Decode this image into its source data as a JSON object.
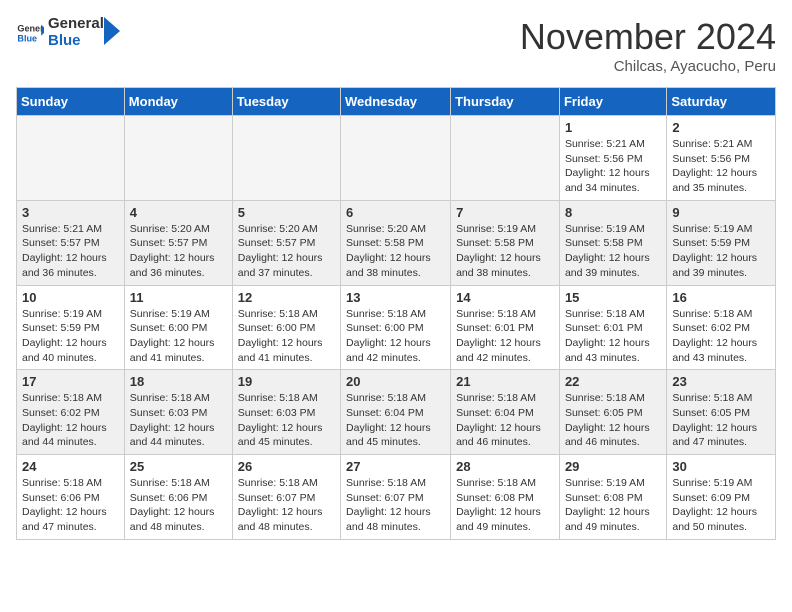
{
  "header": {
    "logo_general": "General",
    "logo_blue": "Blue",
    "month_title": "November 2024",
    "location": "Chilcas, Ayacucho, Peru"
  },
  "weekdays": [
    "Sunday",
    "Monday",
    "Tuesday",
    "Wednesday",
    "Thursday",
    "Friday",
    "Saturday"
  ],
  "weeks": [
    [
      {
        "day": "",
        "info": ""
      },
      {
        "day": "",
        "info": ""
      },
      {
        "day": "",
        "info": ""
      },
      {
        "day": "",
        "info": ""
      },
      {
        "day": "",
        "info": ""
      },
      {
        "day": "1",
        "info": "Sunrise: 5:21 AM\nSunset: 5:56 PM\nDaylight: 12 hours\nand 34 minutes."
      },
      {
        "day": "2",
        "info": "Sunrise: 5:21 AM\nSunset: 5:56 PM\nDaylight: 12 hours\nand 35 minutes."
      }
    ],
    [
      {
        "day": "3",
        "info": "Sunrise: 5:21 AM\nSunset: 5:57 PM\nDaylight: 12 hours\nand 36 minutes."
      },
      {
        "day": "4",
        "info": "Sunrise: 5:20 AM\nSunset: 5:57 PM\nDaylight: 12 hours\nand 36 minutes."
      },
      {
        "day": "5",
        "info": "Sunrise: 5:20 AM\nSunset: 5:57 PM\nDaylight: 12 hours\nand 37 minutes."
      },
      {
        "day": "6",
        "info": "Sunrise: 5:20 AM\nSunset: 5:58 PM\nDaylight: 12 hours\nand 38 minutes."
      },
      {
        "day": "7",
        "info": "Sunrise: 5:19 AM\nSunset: 5:58 PM\nDaylight: 12 hours\nand 38 minutes."
      },
      {
        "day": "8",
        "info": "Sunrise: 5:19 AM\nSunset: 5:58 PM\nDaylight: 12 hours\nand 39 minutes."
      },
      {
        "day": "9",
        "info": "Sunrise: 5:19 AM\nSunset: 5:59 PM\nDaylight: 12 hours\nand 39 minutes."
      }
    ],
    [
      {
        "day": "10",
        "info": "Sunrise: 5:19 AM\nSunset: 5:59 PM\nDaylight: 12 hours\nand 40 minutes."
      },
      {
        "day": "11",
        "info": "Sunrise: 5:19 AM\nSunset: 6:00 PM\nDaylight: 12 hours\nand 41 minutes."
      },
      {
        "day": "12",
        "info": "Sunrise: 5:18 AM\nSunset: 6:00 PM\nDaylight: 12 hours\nand 41 minutes."
      },
      {
        "day": "13",
        "info": "Sunrise: 5:18 AM\nSunset: 6:00 PM\nDaylight: 12 hours\nand 42 minutes."
      },
      {
        "day": "14",
        "info": "Sunrise: 5:18 AM\nSunset: 6:01 PM\nDaylight: 12 hours\nand 42 minutes."
      },
      {
        "day": "15",
        "info": "Sunrise: 5:18 AM\nSunset: 6:01 PM\nDaylight: 12 hours\nand 43 minutes."
      },
      {
        "day": "16",
        "info": "Sunrise: 5:18 AM\nSunset: 6:02 PM\nDaylight: 12 hours\nand 43 minutes."
      }
    ],
    [
      {
        "day": "17",
        "info": "Sunrise: 5:18 AM\nSunset: 6:02 PM\nDaylight: 12 hours\nand 44 minutes."
      },
      {
        "day": "18",
        "info": "Sunrise: 5:18 AM\nSunset: 6:03 PM\nDaylight: 12 hours\nand 44 minutes."
      },
      {
        "day": "19",
        "info": "Sunrise: 5:18 AM\nSunset: 6:03 PM\nDaylight: 12 hours\nand 45 minutes."
      },
      {
        "day": "20",
        "info": "Sunrise: 5:18 AM\nSunset: 6:04 PM\nDaylight: 12 hours\nand 45 minutes."
      },
      {
        "day": "21",
        "info": "Sunrise: 5:18 AM\nSunset: 6:04 PM\nDaylight: 12 hours\nand 46 minutes."
      },
      {
        "day": "22",
        "info": "Sunrise: 5:18 AM\nSunset: 6:05 PM\nDaylight: 12 hours\nand 46 minutes."
      },
      {
        "day": "23",
        "info": "Sunrise: 5:18 AM\nSunset: 6:05 PM\nDaylight: 12 hours\nand 47 minutes."
      }
    ],
    [
      {
        "day": "24",
        "info": "Sunrise: 5:18 AM\nSunset: 6:06 PM\nDaylight: 12 hours\nand 47 minutes."
      },
      {
        "day": "25",
        "info": "Sunrise: 5:18 AM\nSunset: 6:06 PM\nDaylight: 12 hours\nand 48 minutes."
      },
      {
        "day": "26",
        "info": "Sunrise: 5:18 AM\nSunset: 6:07 PM\nDaylight: 12 hours\nand 48 minutes."
      },
      {
        "day": "27",
        "info": "Sunrise: 5:18 AM\nSunset: 6:07 PM\nDaylight: 12 hours\nand 48 minutes."
      },
      {
        "day": "28",
        "info": "Sunrise: 5:18 AM\nSunset: 6:08 PM\nDaylight: 12 hours\nand 49 minutes."
      },
      {
        "day": "29",
        "info": "Sunrise: 5:19 AM\nSunset: 6:08 PM\nDaylight: 12 hours\nand 49 minutes."
      },
      {
        "day": "30",
        "info": "Sunrise: 5:19 AM\nSunset: 6:09 PM\nDaylight: 12 hours\nand 50 minutes."
      }
    ]
  ]
}
